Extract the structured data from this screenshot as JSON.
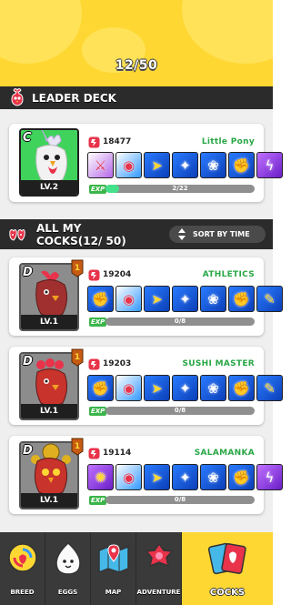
{
  "header": {
    "counter": "12/50"
  },
  "leader_section": {
    "title": "LEADER DECK"
  },
  "all_section": {
    "title": "ALL MY COCKS(12/ 50)",
    "sort_label": "SORT BY TIME"
  },
  "leader_card": {
    "rank": "C",
    "level": "LV.2",
    "power": "18477",
    "name": "Little Pony",
    "exp_label": "EXP",
    "exp_text": "2/22",
    "exp_progress": 0.09,
    "portrait_color": "#3fd35c",
    "skills": [
      "sword",
      "shield",
      "wing",
      "claw",
      "feather",
      "gauntlet",
      "lightning"
    ]
  },
  "cocks": [
    {
      "rank": "D",
      "level": "LV.1",
      "power": "19204",
      "name": "ATHLETICS",
      "exp_label": "EXP",
      "exp_text": "0/8",
      "exp_progress": 0,
      "skills": [
        "fist",
        "shield",
        "wing",
        "claw",
        "feather",
        "gauntlet",
        "hammer"
      ]
    },
    {
      "rank": "D",
      "level": "LV.1",
      "power": "19203",
      "name": "SUSHI MASTER",
      "exp_label": "EXP",
      "exp_text": "0/8",
      "exp_progress": 0,
      "skills": [
        "fist",
        "shield",
        "wing",
        "claw",
        "feather",
        "gauntlet",
        "hammer"
      ]
    },
    {
      "rank": "D",
      "level": "LV.1",
      "power": "19114",
      "name": "SALAMANKA",
      "exp_label": "EXP",
      "exp_text": "0/8",
      "exp_progress": 0,
      "skills": [
        "spark",
        "shield",
        "wing",
        "claw",
        "feather",
        "gauntlet",
        "lightning"
      ]
    }
  ],
  "nav": [
    {
      "label": "BREED",
      "icon": "breed-icon"
    },
    {
      "label": "EGGS",
      "icon": "egg-icon"
    },
    {
      "label": "MAP",
      "icon": "map-icon"
    },
    {
      "label": "ADVENTURE",
      "icon": "adventure-icon"
    },
    {
      "label": "COCKS",
      "icon": "cards-icon"
    }
  ],
  "colors": {
    "accent": "#ffd733",
    "name_green": "#28a745",
    "exp_fill": "#45e08a",
    "dark_bar": "#2b2b2b"
  }
}
